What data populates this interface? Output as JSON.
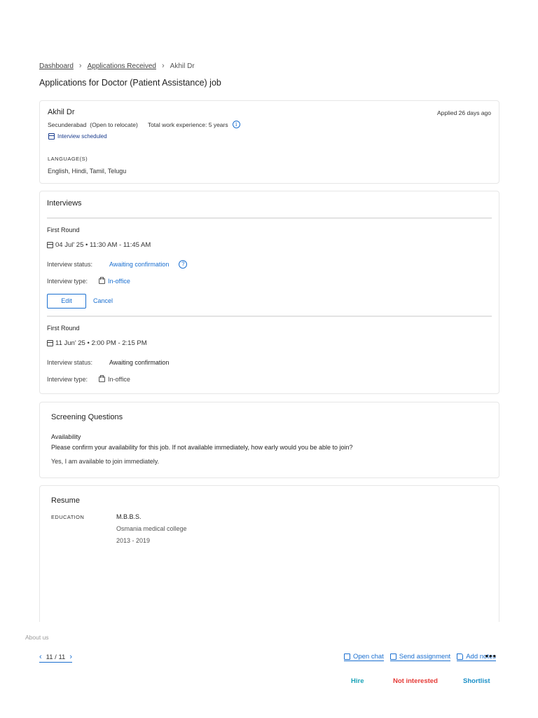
{
  "breadcrumb": {
    "items": [
      "Dashboard",
      "Applications Received"
    ],
    "current": "Akhil Dr"
  },
  "page_title": "Applications for Doctor (Patient Assistance) job",
  "candidate": {
    "name": "Akhil Dr",
    "applied": "Applied 26 days ago",
    "location": "Secunderabad",
    "relocate": "(Open to relocate)",
    "experience": "Total work experience: 5 years",
    "interview_status": "Interview scheduled",
    "language_heading": "LANGUAGE(S)",
    "languages": "English, Hindi, Tamil, Telugu"
  },
  "interviews": {
    "title": "Interviews",
    "status_label": "Interview status:",
    "type_label": "Interview type:",
    "edit_label": "Edit",
    "cancel_label": "Cancel",
    "rounds": [
      {
        "name": "First Round",
        "when": "04 Jul' 25 • 11:30 AM - 11:45 AM",
        "status": "Awaiting confirmation",
        "type": "In-office"
      },
      {
        "name": "First Round",
        "when": "11 Jun' 25 • 2:00 PM - 2:15 PM",
        "status": "Awaiting confirmation",
        "type": "In-office"
      }
    ]
  },
  "screening": {
    "title": "Screening Questions",
    "question_heading": "Availability",
    "question": "Please confirm your availability for this job. If not available immediately, how early would you be able to join?",
    "answer": "Yes, I am available to join immediately."
  },
  "resume": {
    "title": "Resume",
    "education_heading": "EDUCATION",
    "degree": "M.B.B.S.",
    "college": "Osmania medical college",
    "years": "2013 - 2019"
  },
  "footer": {
    "about": "About us"
  },
  "bottom_bar": {
    "pager": "11 / 11",
    "open_chat": "Open chat",
    "send_assignment": "Send assignment",
    "add_notes": "Add notes",
    "more": "•••",
    "hire": "Hire",
    "not_interested": "Not interested",
    "shortlist": "Shortlist"
  },
  "colors": {
    "link": "#1a6fd0",
    "hire": "#1aa3b8",
    "not_interested": "#e53935",
    "shortlist": "#1a8fc7"
  },
  "icons": [
    "chevron-right-icon",
    "info-icon",
    "calendar-icon",
    "help-icon",
    "printer-icon",
    "chevron-left-icon",
    "chat-icon",
    "assignment-icon",
    "notes-icon",
    "more-icon"
  ]
}
